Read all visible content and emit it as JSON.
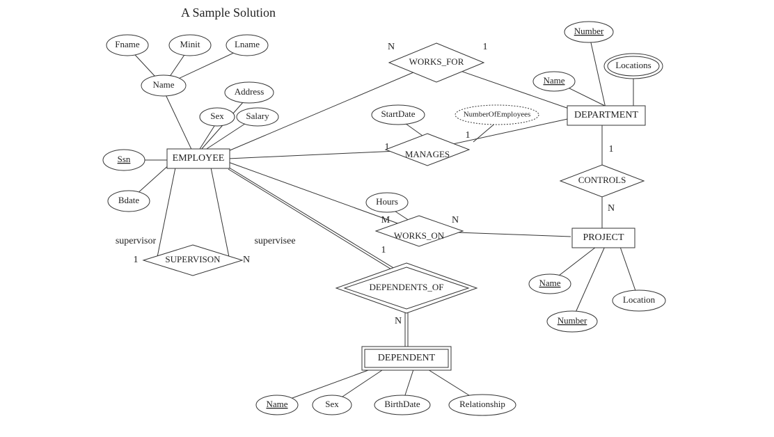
{
  "title": "A Sample Solution",
  "entities": {
    "employee": "EMPLOYEE",
    "department": "DEPARTMENT",
    "project": "PROJECT",
    "dependent": "DEPENDENT"
  },
  "relationships": {
    "works_for": "WORKS_FOR",
    "manages": "MANAGES",
    "controls": "CONTROLS",
    "works_on": "WORKS_ON",
    "supervision": "SUPERVISON",
    "dependents_of": "DEPENDENTS_OF"
  },
  "attributes": {
    "fname": "Fname",
    "minit": "Minit",
    "lname": "Lname",
    "name": "Name",
    "address": "Address",
    "sex": "Sex",
    "salary": "Salary",
    "ssn": "Ssn",
    "bdate": "Bdate",
    "dept_number": "Number",
    "dept_name": "Name",
    "locations": "Locations",
    "num_emp": "NumberOfEmployees",
    "startdate": "StartDate",
    "hours": "Hours",
    "proj_name": "Name",
    "proj_number": "Number",
    "proj_location": "Location",
    "dep_name": "Name",
    "dep_sex": "Sex",
    "dep_birthdate": "BirthDate",
    "dep_relationship": "Relationship"
  },
  "roles": {
    "supervisor": "supervisor",
    "supervisee": "supervisee"
  },
  "cardinality": {
    "wf_emp": "N",
    "wf_dept": "1",
    "mg_emp": "1",
    "mg_dept": "1",
    "ctrl_dept": "1",
    "ctrl_proj": "N",
    "wo_emp": "M",
    "wo_proj": "N",
    "sup_sup": "1",
    "sup_sub": "N",
    "dep_emp": "1",
    "dep_dep": "N"
  }
}
